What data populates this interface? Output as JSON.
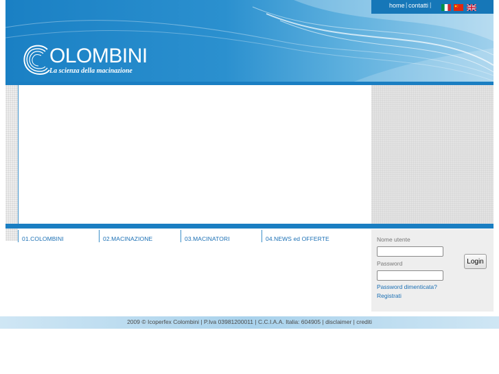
{
  "topnav": {
    "home": "home",
    "separator": "|",
    "contatti": "contatti",
    "separator2": "|"
  },
  "flags": [
    {
      "name": "italian-flag-icon",
      "colors": [
        "#009246",
        "#ffffff",
        "#ce2b37"
      ]
    },
    {
      "name": "chinese-flag-icon",
      "colors": [
        "#de2910",
        "#ffde00"
      ]
    },
    {
      "name": "uk-flag-icon",
      "colors": [
        "#012169",
        "#ffffff",
        "#c8102e"
      ]
    }
  ],
  "logo": {
    "brand": "OLOMBINI",
    "tagline": "La scienza della macinazione"
  },
  "menu": {
    "items": [
      {
        "label": "01.COLOMBINI"
      },
      {
        "label": "02.MACINAZIONE"
      },
      {
        "label": "03.MACINATORI"
      },
      {
        "label": "04.NEWS ed OFFERTE"
      }
    ]
  },
  "login": {
    "username_label": "Nome utente",
    "username_value": "",
    "password_label": "Password",
    "password_value": "",
    "button_label": "Login",
    "forgot_link": "Password dimenticata?",
    "register_link": "Registrati"
  },
  "footer": {
    "text": "2009 © Icoperfex Colombini | P.Iva 03981200011 | C.C.I.A.A. Italia: 604905 | disclaimer | crediti"
  },
  "colors": {
    "brand_blue": "#1a7ec2",
    "link_blue": "#1a6fb4",
    "panel_gray": "#e3e3e3"
  }
}
